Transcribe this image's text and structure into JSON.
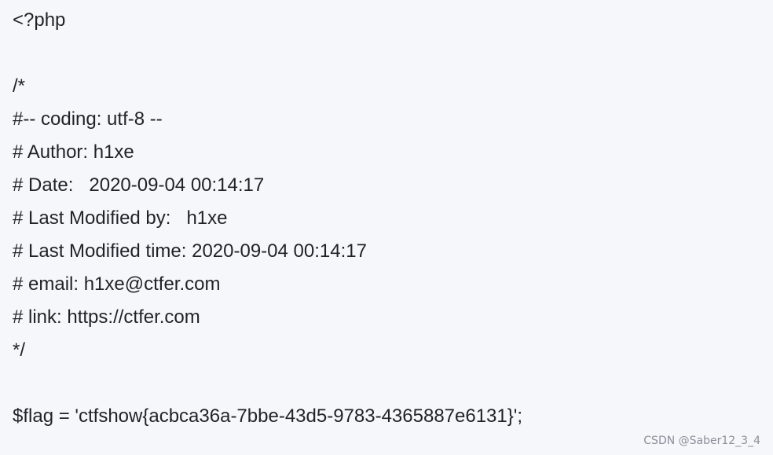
{
  "code": {
    "lines": [
      "<?php",
      "",
      "/*",
      "#-- coding: utf-8 --",
      "# Author: h1xe",
      "# Date:   2020-09-04 00:14:17",
      "# Last Modified by:   h1xe",
      "# Last Modified time: 2020-09-04 00:14:17",
      "# email: h1xe@ctfer.com",
      "# link: https://ctfer.com",
      "*/",
      "",
      "$flag = 'ctfshow{acbca36a-7bbe-43d5-9783-4365887e6131}';"
    ]
  },
  "watermark": {
    "text": "CSDN @Saber12_3_4"
  }
}
